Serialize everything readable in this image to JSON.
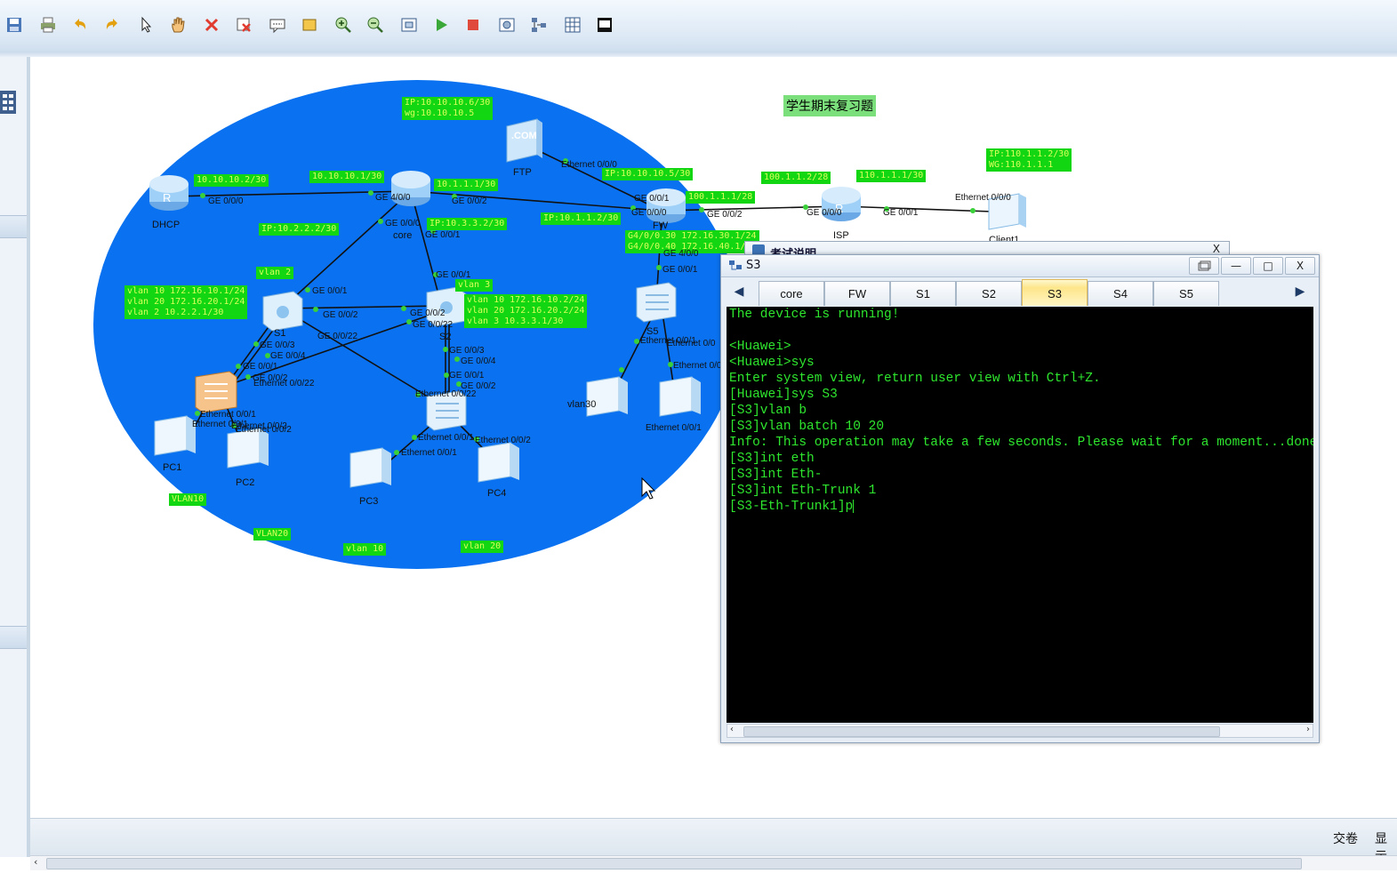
{
  "toolbar": {
    "buttons": [
      "save-icon",
      "print-icon",
      "undo-icon",
      "redo-icon",
      "pointer-icon",
      "hand-icon",
      "delete-icon",
      "delete-link-icon",
      "text-note-icon",
      "rectangle-icon",
      "zoom-in-icon",
      "zoom-out-icon",
      "fit-icon",
      "start-icon",
      "stop-icon",
      "capture-icon",
      "topology-icon",
      "grid-icon",
      "console-icon"
    ]
  },
  "canvas": {
    "title_note": "学生期末复习题",
    "devices": {
      "dhcp": "DHCP",
      "core": "core",
      "ftp": "FTP",
      "fw": "FW",
      "isp": "ISP",
      "client1": "Client1",
      "s1": "S1",
      "s2": "S2",
      "s5": "S5",
      "pc1": "PC1",
      "pc2": "PC2",
      "pc3": "PC3",
      "pc4": "PC4",
      "vlan30": "vlan30",
      "ftp_logo": ".COM"
    },
    "labels": {
      "ftp_ip": "IP:10.10.10.6/30\nwg:10.10.10.5",
      "dhcp_ip": "10.10.10.2/30",
      "core_ip1": "10.10.10.1/30",
      "core_ip2": "10.1.1.1/30",
      "core_ip3": "IP:10.2.2.2/30",
      "core_ip4": "IP:10.3.3.2/30",
      "fw_ip1": "IP:10.1.1.2/30",
      "fw_ftp": "IP:10.10.10.5/30",
      "fw_ip2": "100.1.1.1/28",
      "fw_vlan": "G4/0/0.30 172.16.30.1/24\nG4/0/0.40 172.16.40.1/24",
      "isp_ip1": "100.1.1.2/28",
      "isp_ip2": "110.1.1.1/30",
      "client_ip": "IP:110.1.1.2/30\nWG:110.1.1.1",
      "vlan2": "vlan 2",
      "vlan3": "vlan 3",
      "s1_vlans": "vlan 10 172.16.10.1/24\nvlan 20 172.16.20.1/24\nvlan 2 10.2.2.1/30",
      "s2_vlans": "vlan 10 172.16.10.2/24\nvlan 20 172.16.20.2/24\nvlan 3 10.3.3.1/30",
      "vlan10a": "VLAN10",
      "vlan20a": "VLAN20",
      "vlan10b": "vlan 10",
      "vlan20b": "vlan 20"
    },
    "ports": {
      "p1": "GE 0/0/0",
      "p2": "GE 4/0/0",
      "p3": "GE 0/0/2",
      "p4": "GE 0/0/0",
      "p5": "GE 0/0/1",
      "p6": "Ethernet 0/0/0",
      "p7": "GE 0/0/1",
      "p8": "GE 0/0/0",
      "p9": "GE 0/0/2",
      "p10": "GE 0/0/0",
      "p11": "GE 0/0/1",
      "p12": "Ethernet 0/0/0",
      "p13": "GE 4/0/0",
      "p14": "GE 0/0/1",
      "p15": "GE 0/0/1",
      "p16": "GE 0/0/1",
      "p17": "GE 0/0/2",
      "p18": "GE 0/0/2",
      "p19": "GE 0/0/22",
      "p20": "GE 0/0/3",
      "p21": "GE 0/0/4",
      "p22": "GE 0/0/1",
      "p23": "GE 0/0/2",
      "p24": "Ethernet 0/0/22",
      "p25": "GE 0/0/22",
      "p26": "GE 0/0/3",
      "p27": "GE 0/0/4",
      "p28": "GE 0/0/1",
      "p29": "GE 0/0/2",
      "p30": "Ethernet 0/0/22",
      "p31": "Ethernet 0/0/1",
      "p32": "Ethernet 0/0/1",
      "p33": "Ethernet 0/0/2",
      "p34": "Ethernet 0/0/1",
      "p35": "Ethernet 0/0/2",
      "p36": "Ethernet 0/0/1",
      "p37": "Ethernet 0/0/1",
      "p38": "Ethernet 0/0/2",
      "p39": "Ethernet 0/0/1",
      "p40": "Ethernet 0/0",
      "p41": "Ethernet 0/0"
    }
  },
  "exam_window": {
    "title": "考试说明",
    "close": "X"
  },
  "terminal": {
    "title": "S3",
    "controls": {
      "minimize": "—",
      "maximize": "□",
      "close": "X"
    },
    "tabs": [
      "core",
      "FW",
      "S1",
      "S2",
      "S3",
      "S4",
      "S5"
    ],
    "active_tab": "S3",
    "lines": [
      "The device is running!",
      "",
      "<Huawei>",
      "<Huawei>sys",
      "Enter system view, return user view with Ctrl+Z.",
      "[Huawei]sys S3",
      "[S3]vlan b",
      "[S3]vlan batch 10 20",
      "Info: This operation may take a few seconds. Please wait for a moment...done.",
      "[S3]int eth",
      "[S3]int Eth-",
      "[S3]int Eth-Trunk 1",
      "[S3-Eth-Trunk1]p"
    ]
  },
  "status": {
    "submit": "交卷",
    "display": "显示"
  },
  "colors": {
    "topology_ellipse": "#0a72f0",
    "label_bg": "#13d613",
    "console_text": "#2ee62e"
  }
}
